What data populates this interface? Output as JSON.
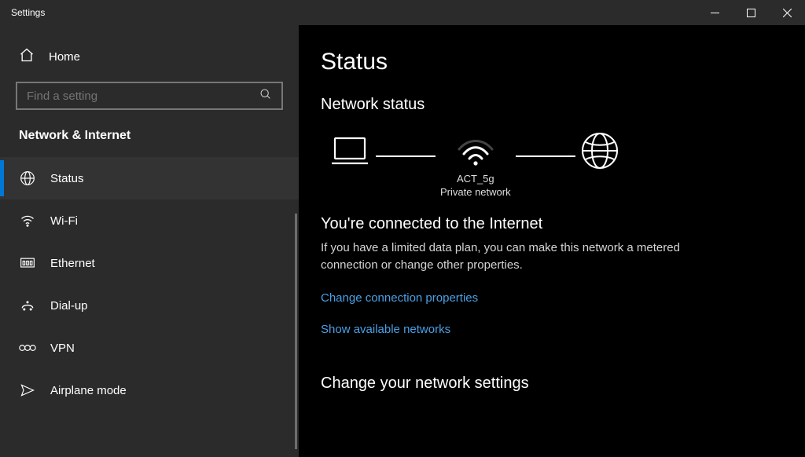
{
  "window": {
    "title": "Settings"
  },
  "sidebar": {
    "home": "Home",
    "search_placeholder": "Find a setting",
    "section_title": "Network & Internet",
    "items": [
      {
        "label": "Status"
      },
      {
        "label": "Wi-Fi"
      },
      {
        "label": "Ethernet"
      },
      {
        "label": "Dial-up"
      },
      {
        "label": "VPN"
      },
      {
        "label": "Airplane mode"
      }
    ]
  },
  "content": {
    "page_title": "Status",
    "subheading": "Network status",
    "diagram": {
      "wifi_name": "ACT_5g",
      "wifi_type": "Private network"
    },
    "connected_heading": "You're connected to the Internet",
    "connected_desc": "If you have a limited data plan, you can make this network a metered connection or change other properties.",
    "link_change_props": "Change connection properties",
    "link_show_networks": "Show available networks",
    "section2_heading": "Change your network settings"
  }
}
